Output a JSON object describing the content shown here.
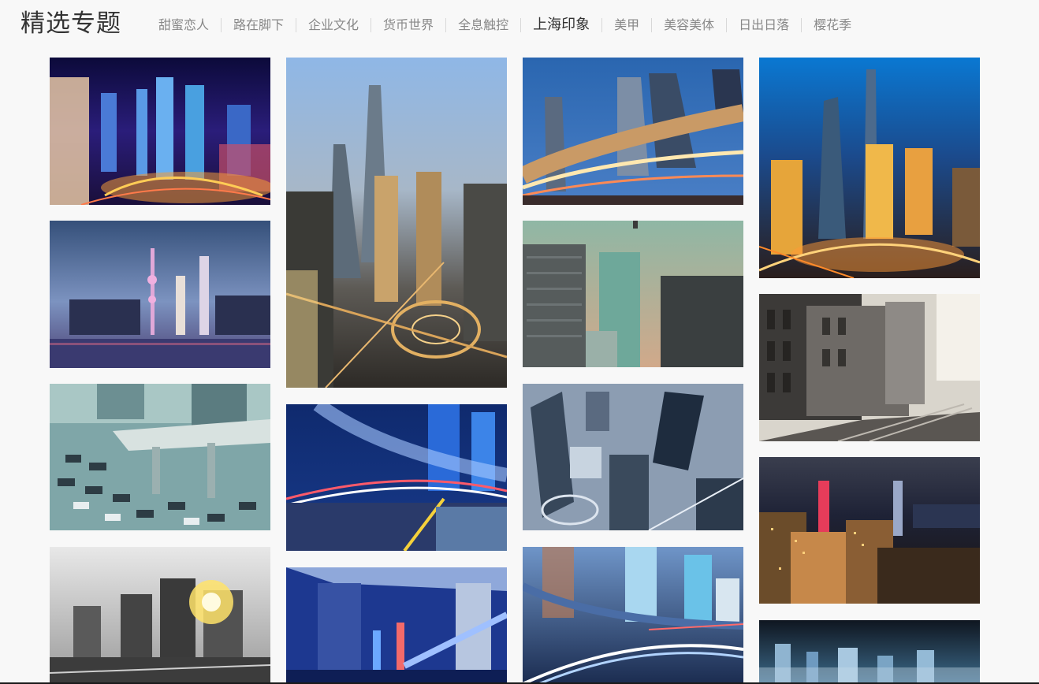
{
  "header": {
    "title": "精选专题",
    "tabs": [
      {
        "label": "甜蜜恋人",
        "active": false
      },
      {
        "label": "路在脚下",
        "active": false
      },
      {
        "label": "企业文化",
        "active": false
      },
      {
        "label": "货币世界",
        "active": false
      },
      {
        "label": "全息触控",
        "active": false
      },
      {
        "label": "上海印象",
        "active": true
      },
      {
        "label": "美甲",
        "active": false
      },
      {
        "label": "美容美体",
        "active": false
      },
      {
        "label": "日出日落",
        "active": false
      },
      {
        "label": "樱花季",
        "active": false
      }
    ]
  },
  "gallery": {
    "columns": [
      [
        {
          "name": "pudong-night-aerial-photo",
          "theme": "night-purple"
        },
        {
          "name": "oriental-pearl-dusk-river-photo",
          "theme": "dusk-river"
        },
        {
          "name": "elevated-highway-traffic-photo",
          "theme": "traffic-teal"
        },
        {
          "name": "bw-skyscrapers-sunburst-photo",
          "theme": "bw-sun"
        }
      ],
      [
        {
          "name": "lujiazui-aerial-dusk-photo",
          "theme": "aerial-dusk"
        },
        {
          "name": "light-trails-overpass-photo",
          "theme": "blue-trails"
        },
        {
          "name": "blue-overpass-night-photo",
          "theme": "blue-overpass"
        }
      ],
      [
        {
          "name": "fisheye-towers-light-trails-photo",
          "theme": "fisheye-night"
        },
        {
          "name": "green-tinted-office-towers-photo",
          "theme": "green-towers"
        },
        {
          "name": "desaturated-blue-aerial-photo",
          "theme": "cold-aerial"
        },
        {
          "name": "curved-road-light-trails-photo",
          "theme": "blue-road"
        }
      ],
      [
        {
          "name": "pudong-golden-night-aerial-photo",
          "theme": "gold-night"
        },
        {
          "name": "bw-european-street-photo",
          "theme": "bw-street"
        },
        {
          "name": "harbour-skyline-night-photo",
          "theme": "harbour-night"
        },
        {
          "name": "blue-night-cityscape-photo",
          "theme": "blue-city"
        }
      ]
    ]
  }
}
